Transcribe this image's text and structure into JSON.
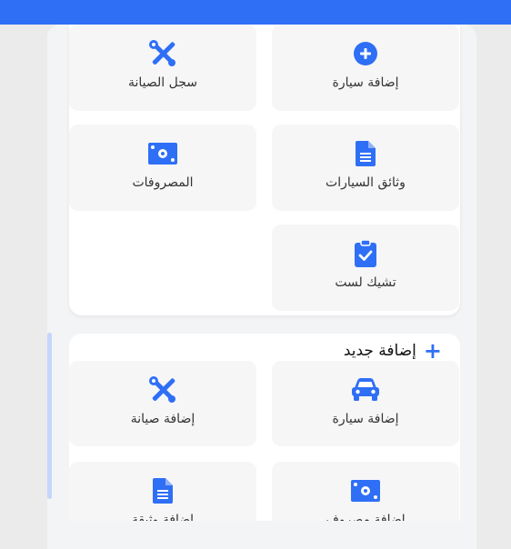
{
  "colors": {
    "accent": "#2f6ff6",
    "background": "#ebebeb",
    "card": "#ffffff",
    "tile": "#f6f6f7"
  },
  "top_section": {
    "tiles": [
      {
        "label": "إضافة سيارة",
        "icon": "plus-circle-icon"
      },
      {
        "label": "سجل الصيانة",
        "icon": "tools-icon"
      },
      {
        "label": "وثائق السيارات",
        "icon": "document-icon"
      },
      {
        "label": "المصروفات",
        "icon": "money-icon"
      },
      {
        "label": "تشيك لست",
        "icon": "clipboard-check-icon"
      }
    ]
  },
  "add_section": {
    "title": "إضافة جديد",
    "icon": "plus-icon",
    "tiles": [
      {
        "label": "إضافة سيارة",
        "icon": "car-icon"
      },
      {
        "label": "إضافة صيانة",
        "icon": "tools-icon"
      },
      {
        "label": "إضافة مصروف",
        "icon": "money-icon"
      },
      {
        "label": "إضافة وثيقة",
        "icon": "document-icon"
      }
    ]
  }
}
